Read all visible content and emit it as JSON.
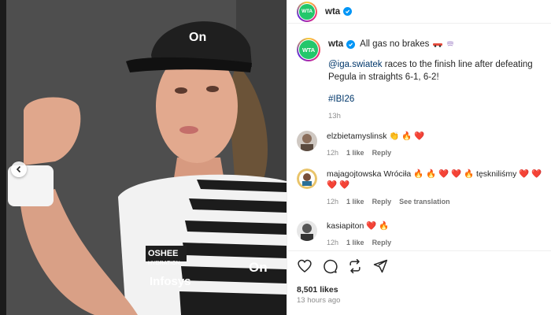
{
  "post": {
    "username": "wta",
    "avatar_text": "WTA",
    "caption_lead": "All gas no brakes",
    "caption_mention": "@iga.swiatek",
    "caption_text": " races to the finish line after defeating Pegula in straights 6-1, 6-2!",
    "hashtag": "#IBI26",
    "posted_ago_short": "13h",
    "likes": "8,501 likes",
    "posted_ago_long": "13 hours ago"
  },
  "photo": {
    "cap_brand": "On",
    "shirt_sponsor_1": "OSHEE",
    "shirt_sponsor_1_sub": "HYDRATION",
    "shirt_sponsor_2": "Infosys",
    "shirt_brand": "On"
  },
  "comments": [
    {
      "username": "elzbietamyslinsk",
      "text": "👏 🔥 ❤️",
      "time": "12h",
      "likes": "1 like",
      "reply": "Reply"
    },
    {
      "username": "majagojtowska",
      "text": " Wróciła 🔥 🔥 ❤️ ❤️ 🔥 tęskniliśmy ❤️ ❤️ ❤️ ❤️",
      "time": "12h",
      "likes": "1 like",
      "reply": "Reply",
      "translate": "See translation"
    },
    {
      "username": "kasiapiton",
      "text": " ❤️ 🔥",
      "time": "12h",
      "likes": "1 like",
      "reply": "Reply"
    }
  ],
  "colors": {
    "wta_green": "#23c76b",
    "link_blue": "#00376b",
    "verified_blue": "#0095f6",
    "heart_red": "#ed4956"
  }
}
